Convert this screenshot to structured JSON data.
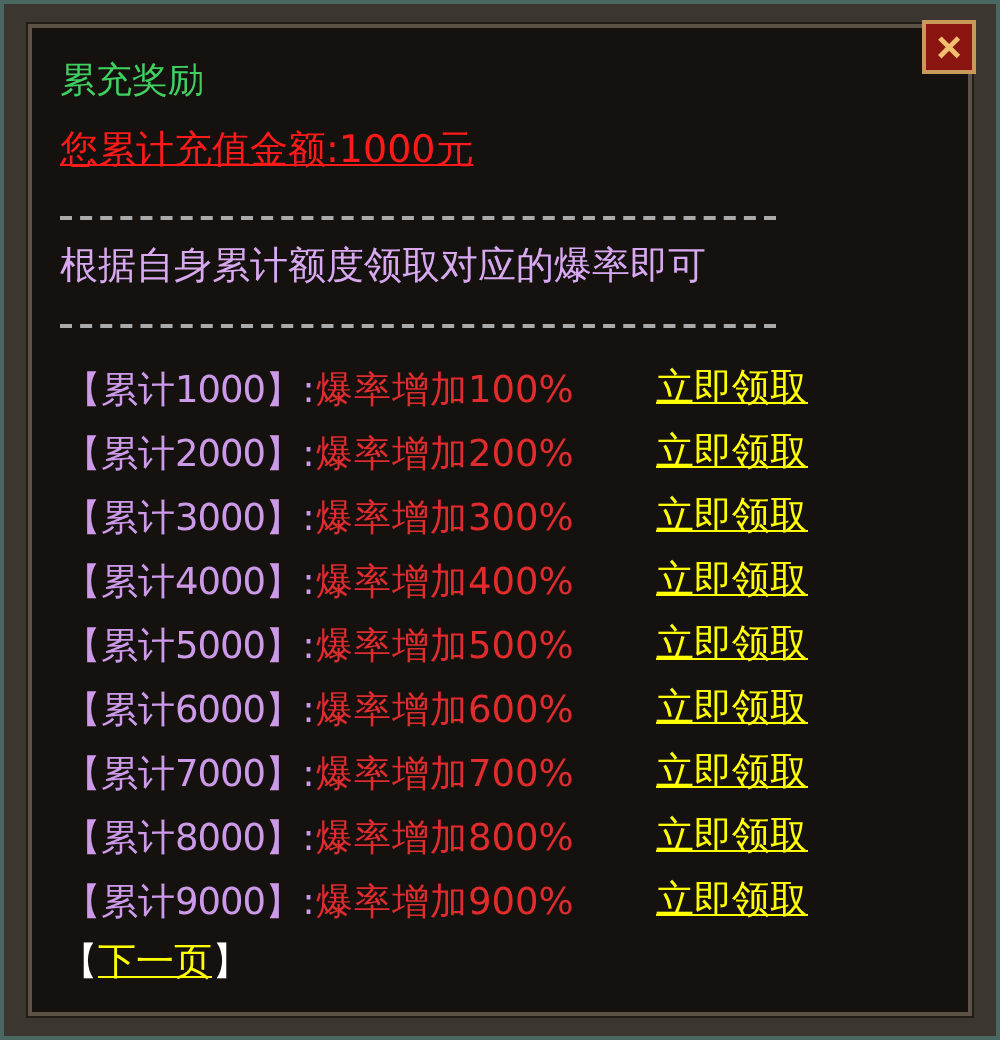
{
  "window": {
    "title": "累充奖励",
    "close": "×"
  },
  "total": "您累计充值金额:1000元",
  "instruction": "根据自身累计额度领取对应的爆率即可",
  "rows": [
    {
      "tier": "【累计1000】:",
      "bonus": "爆率增加100%",
      "action": "立即领取"
    },
    {
      "tier": "【累计2000】:",
      "bonus": "爆率增加200%",
      "action": "立即领取"
    },
    {
      "tier": "【累计3000】:",
      "bonus": "爆率增加300%",
      "action": "立即领取"
    },
    {
      "tier": "【累计4000】:",
      "bonus": "爆率增加400%",
      "action": "立即领取"
    },
    {
      "tier": "【累计5000】:",
      "bonus": "爆率增加500%",
      "action": "立即领取"
    },
    {
      "tier": "【累计6000】:",
      "bonus": "爆率增加600%",
      "action": "立即领取"
    },
    {
      "tier": "【累计7000】:",
      "bonus": "爆率增加700%",
      "action": "立即领取"
    },
    {
      "tier": "【累计8000】:",
      "bonus": "爆率增加800%",
      "action": "立即领取"
    },
    {
      "tier": "【累计9000】:",
      "bonus": "爆率增加900%",
      "action": "立即领取"
    }
  ],
  "next_page": {
    "open": "【",
    "label": "下一页",
    "close": "】"
  }
}
